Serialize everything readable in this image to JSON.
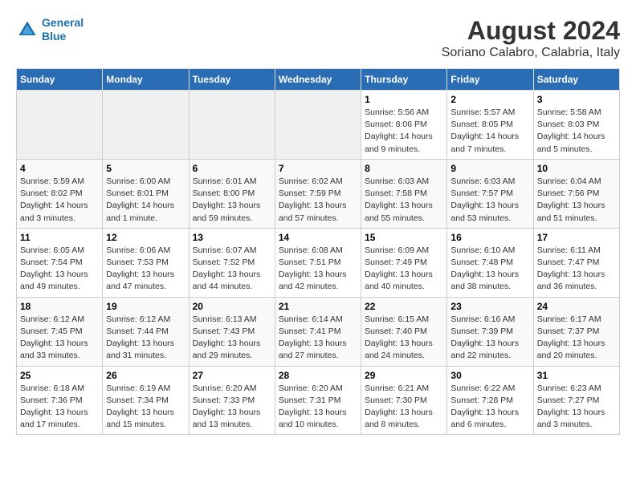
{
  "header": {
    "logo_line1": "General",
    "logo_line2": "Blue",
    "title": "August 2024",
    "subtitle": "Soriano Calabro, Calabria, Italy"
  },
  "days_of_week": [
    "Sunday",
    "Monday",
    "Tuesday",
    "Wednesday",
    "Thursday",
    "Friday",
    "Saturday"
  ],
  "weeks": [
    [
      {
        "day": "",
        "detail": ""
      },
      {
        "day": "",
        "detail": ""
      },
      {
        "day": "",
        "detail": ""
      },
      {
        "day": "",
        "detail": ""
      },
      {
        "day": "1",
        "detail": "Sunrise: 5:56 AM\nSunset: 8:06 PM\nDaylight: 14 hours\nand 9 minutes."
      },
      {
        "day": "2",
        "detail": "Sunrise: 5:57 AM\nSunset: 8:05 PM\nDaylight: 14 hours\nand 7 minutes."
      },
      {
        "day": "3",
        "detail": "Sunrise: 5:58 AM\nSunset: 8:03 PM\nDaylight: 14 hours\nand 5 minutes."
      }
    ],
    [
      {
        "day": "4",
        "detail": "Sunrise: 5:59 AM\nSunset: 8:02 PM\nDaylight: 14 hours\nand 3 minutes."
      },
      {
        "day": "5",
        "detail": "Sunrise: 6:00 AM\nSunset: 8:01 PM\nDaylight: 14 hours\nand 1 minute."
      },
      {
        "day": "6",
        "detail": "Sunrise: 6:01 AM\nSunset: 8:00 PM\nDaylight: 13 hours\nand 59 minutes."
      },
      {
        "day": "7",
        "detail": "Sunrise: 6:02 AM\nSunset: 7:59 PM\nDaylight: 13 hours\nand 57 minutes."
      },
      {
        "day": "8",
        "detail": "Sunrise: 6:03 AM\nSunset: 7:58 PM\nDaylight: 13 hours\nand 55 minutes."
      },
      {
        "day": "9",
        "detail": "Sunrise: 6:03 AM\nSunset: 7:57 PM\nDaylight: 13 hours\nand 53 minutes."
      },
      {
        "day": "10",
        "detail": "Sunrise: 6:04 AM\nSunset: 7:56 PM\nDaylight: 13 hours\nand 51 minutes."
      }
    ],
    [
      {
        "day": "11",
        "detail": "Sunrise: 6:05 AM\nSunset: 7:54 PM\nDaylight: 13 hours\nand 49 minutes."
      },
      {
        "day": "12",
        "detail": "Sunrise: 6:06 AM\nSunset: 7:53 PM\nDaylight: 13 hours\nand 47 minutes."
      },
      {
        "day": "13",
        "detail": "Sunrise: 6:07 AM\nSunset: 7:52 PM\nDaylight: 13 hours\nand 44 minutes."
      },
      {
        "day": "14",
        "detail": "Sunrise: 6:08 AM\nSunset: 7:51 PM\nDaylight: 13 hours\nand 42 minutes."
      },
      {
        "day": "15",
        "detail": "Sunrise: 6:09 AM\nSunset: 7:49 PM\nDaylight: 13 hours\nand 40 minutes."
      },
      {
        "day": "16",
        "detail": "Sunrise: 6:10 AM\nSunset: 7:48 PM\nDaylight: 13 hours\nand 38 minutes."
      },
      {
        "day": "17",
        "detail": "Sunrise: 6:11 AM\nSunset: 7:47 PM\nDaylight: 13 hours\nand 36 minutes."
      }
    ],
    [
      {
        "day": "18",
        "detail": "Sunrise: 6:12 AM\nSunset: 7:45 PM\nDaylight: 13 hours\nand 33 minutes."
      },
      {
        "day": "19",
        "detail": "Sunrise: 6:12 AM\nSunset: 7:44 PM\nDaylight: 13 hours\nand 31 minutes."
      },
      {
        "day": "20",
        "detail": "Sunrise: 6:13 AM\nSunset: 7:43 PM\nDaylight: 13 hours\nand 29 minutes."
      },
      {
        "day": "21",
        "detail": "Sunrise: 6:14 AM\nSunset: 7:41 PM\nDaylight: 13 hours\nand 27 minutes."
      },
      {
        "day": "22",
        "detail": "Sunrise: 6:15 AM\nSunset: 7:40 PM\nDaylight: 13 hours\nand 24 minutes."
      },
      {
        "day": "23",
        "detail": "Sunrise: 6:16 AM\nSunset: 7:39 PM\nDaylight: 13 hours\nand 22 minutes."
      },
      {
        "day": "24",
        "detail": "Sunrise: 6:17 AM\nSunset: 7:37 PM\nDaylight: 13 hours\nand 20 minutes."
      }
    ],
    [
      {
        "day": "25",
        "detail": "Sunrise: 6:18 AM\nSunset: 7:36 PM\nDaylight: 13 hours\nand 17 minutes."
      },
      {
        "day": "26",
        "detail": "Sunrise: 6:19 AM\nSunset: 7:34 PM\nDaylight: 13 hours\nand 15 minutes."
      },
      {
        "day": "27",
        "detail": "Sunrise: 6:20 AM\nSunset: 7:33 PM\nDaylight: 13 hours\nand 13 minutes."
      },
      {
        "day": "28",
        "detail": "Sunrise: 6:20 AM\nSunset: 7:31 PM\nDaylight: 13 hours\nand 10 minutes."
      },
      {
        "day": "29",
        "detail": "Sunrise: 6:21 AM\nSunset: 7:30 PM\nDaylight: 13 hours\nand 8 minutes."
      },
      {
        "day": "30",
        "detail": "Sunrise: 6:22 AM\nSunset: 7:28 PM\nDaylight: 13 hours\nand 6 minutes."
      },
      {
        "day": "31",
        "detail": "Sunrise: 6:23 AM\nSunset: 7:27 PM\nDaylight: 13 hours\nand 3 minutes."
      }
    ]
  ]
}
